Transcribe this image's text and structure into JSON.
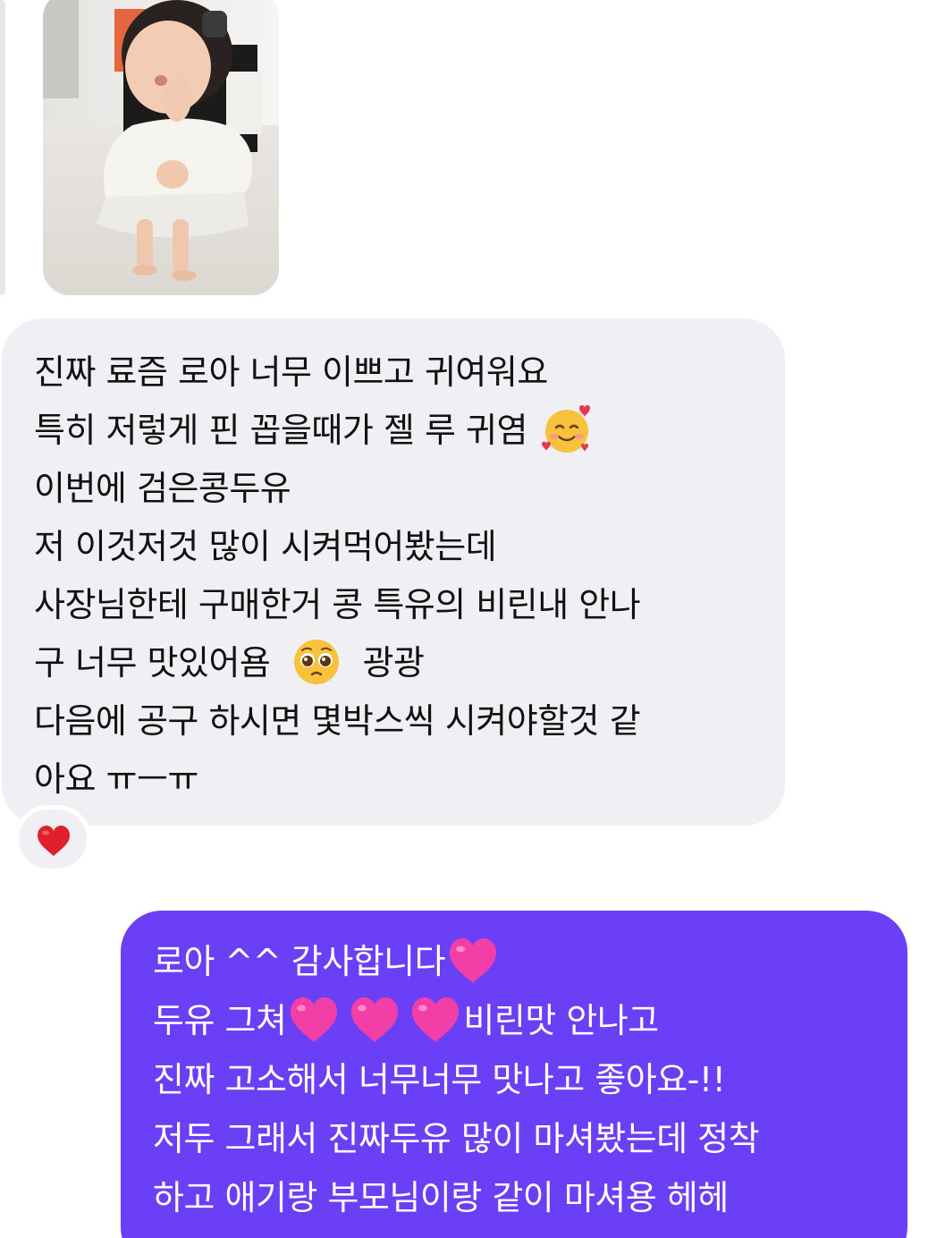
{
  "incoming_message": {
    "lines": [
      "진짜 료즘 로아 너무 이쁘고 귀여워요",
      "특히 저렇게 핀 꼽을때가 젤 루 귀염",
      "이번에 검은콩두유",
      "저 이것저것 많이 시켜먹어봤는데",
      "사장님한테 구매한거 콩 특유의 비린내 안나",
      "구 너무 맛있어욤",
      "광광",
      "다음에 공구 하시면 몇박스씩 시켜야할것 같",
      "아요 ㅠㅡㅠ"
    ],
    "emojis": [
      "smiling-face-with-hearts",
      "pleading-face"
    ],
    "reaction": "red-heart"
  },
  "outgoing_message": {
    "lines": [
      "로아 ^^ 감사합니다",
      "두유 그쳐",
      "비린맛 안나고",
      "진짜 고소해서 너무너무 맛나고 좋아요-!!",
      "저두 그래서 진짜두유 많이 마셔봤는데 정착",
      "하고 애기랑 부모님이랑 같이 마셔용 헤헤"
    ],
    "emojis": [
      "pink-heart",
      "pink-heart",
      "pink-heart",
      "pink-heart"
    ]
  },
  "colors": {
    "incoming_bubble": "#efeff4",
    "outgoing_bubble": "#6b3ff5",
    "incoming_text": "#111111",
    "outgoing_text": "#ffffff",
    "reaction_heart": "#e0202a",
    "pink_heart": "#f23fa7"
  }
}
